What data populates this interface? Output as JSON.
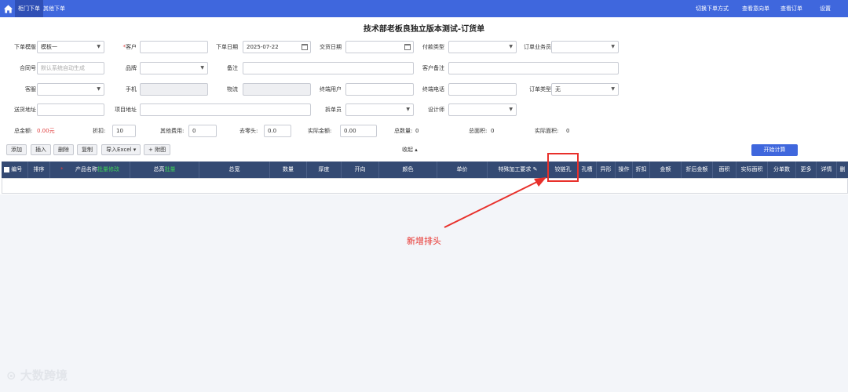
{
  "topbar": {
    "tab_active": "柜门下单",
    "tab_other": "其他下单",
    "links": [
      "切换下单方式",
      "查看意向单",
      "查看订单",
      "设置"
    ]
  },
  "page_title": "技术部老板良独立版本测试-订货单",
  "form": {
    "template_label": "下单模版",
    "template_value": "模板一",
    "customer_label": "客户",
    "order_date_label": "下单日期",
    "order_date_value": "2025-07-22",
    "delivery_date_label": "交货日期",
    "payment_type_label": "付款类型",
    "salesperson_label": "订单业务员",
    "contract_label": "合同号",
    "contract_placeholder": "默认系统自动生成",
    "brand_label": "品牌",
    "remark_label": "备注",
    "customer_remark_label": "客户备注",
    "service_label": "客服",
    "phone_label": "手机",
    "logistics_label": "物流",
    "end_user_label": "终端用户",
    "end_phone_label": "终端电话",
    "order_type_label": "订单类型",
    "order_type_value": "无",
    "address_label": "送货地址",
    "project_address_label": "项目地址",
    "splitter_label": "拆单员",
    "designer_label": "设计师"
  },
  "summary": {
    "total_amount_label": "总金额:",
    "total_amount_value": "0.00元",
    "discount_label": "折扣:",
    "discount_value": "10",
    "other_fee_label": "其他费用:",
    "other_fee_value": "0",
    "round_label": "去零头:",
    "round_value": "0.0",
    "actual_amount_label": "实际金额:",
    "actual_amount_value": "0.00",
    "total_qty_label": "总数量:",
    "total_qty_value": "0",
    "total_area_label": "总面积:",
    "total_area_value": "0",
    "actual_area_label": "实际面积:",
    "actual_area_value": "0"
  },
  "toolbar": {
    "add": "添加",
    "insert": "插入",
    "delete": "删除",
    "copy": "复制",
    "import_excel": "导入Excel",
    "attach": "+ 附图",
    "collapse": "收起",
    "calculate": "开始计算"
  },
  "table_headers": [
    "编号",
    "排序",
    "产品名称",
    "批量修改",
    "总高",
    "批量",
    "总宽",
    "数量",
    "厚度",
    "开向",
    "颜色",
    "单价",
    "特殊加工要求",
    "铰链孔",
    "孔槽",
    "异形",
    "操作",
    "折扣",
    "金额",
    "折后金额",
    "面积",
    "实际面积",
    "分单数",
    "更多",
    "详情",
    "删"
  ],
  "annotation": "新增排头",
  "watermark": "大数跨境"
}
